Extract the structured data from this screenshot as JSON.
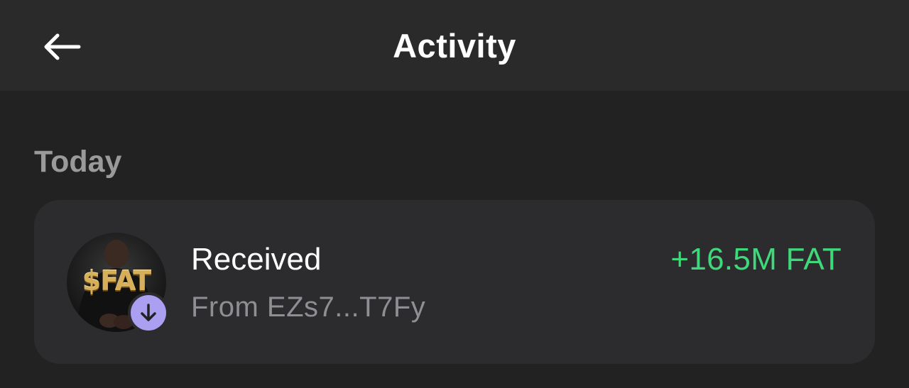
{
  "header": {
    "title": "Activity",
    "back_icon": "arrow-left-icon"
  },
  "section": {
    "label": "Today"
  },
  "transactions": [
    {
      "type": "Received",
      "from": "From EZs7...T7Fy",
      "amount": "+16.5M FAT",
      "token_logo_text": "$FAT",
      "badge_icon": "arrow-down-icon",
      "amount_color": "#3fd87a",
      "badge_color": "#ab9ff2"
    }
  ],
  "colors": {
    "background": "#222222",
    "header_background": "#2a2a2a",
    "card_background": "#2c2c2f",
    "positive": "#3fd87a",
    "accent": "#ab9ff2"
  }
}
